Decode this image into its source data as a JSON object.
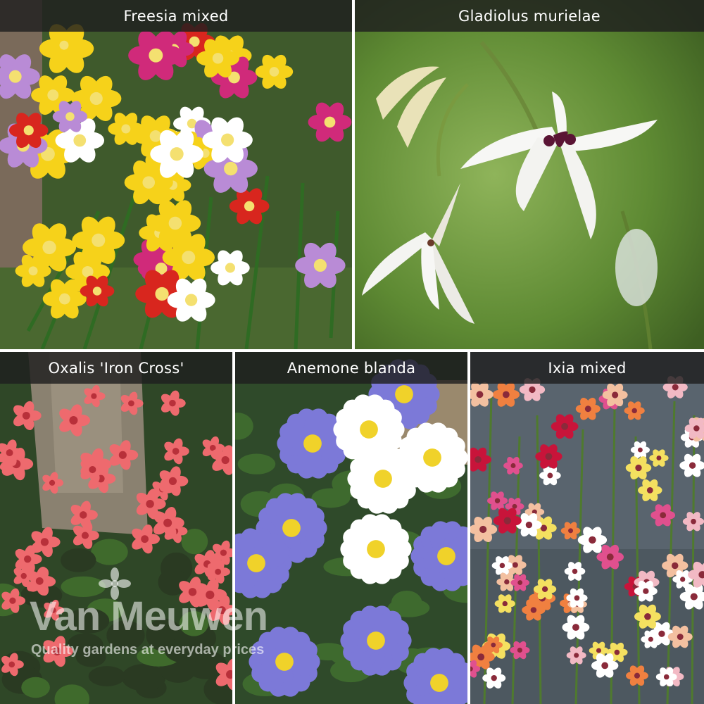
{
  "tiles": [
    {
      "caption": "Freesia mixed"
    },
    {
      "caption": "Gladiolus murielae"
    },
    {
      "caption": "Oxalis 'Iron Cross'"
    },
    {
      "caption": "Anemone blanda"
    },
    {
      "caption": "Ixia mixed"
    }
  ],
  "watermark": {
    "brand": "Van Meuwen",
    "tagline": "Quality gardens at everyday prices"
  },
  "colors": {
    "caption_bar": "#1e1e1e",
    "freesia_yellow": "#f6d21a",
    "freesia_red": "#d8261e",
    "freesia_magenta": "#d02a7a",
    "freesia_lilac": "#b98bd6",
    "gladiolus_white": "#f7f7f5",
    "gladiolus_blotch": "#5a1434",
    "gladiolus_bg": "#6f9a3e",
    "oxalis_pink": "#ee6a6e",
    "anemone_blue": "#7c79d8",
    "ixia_pink": "#e0508e"
  }
}
